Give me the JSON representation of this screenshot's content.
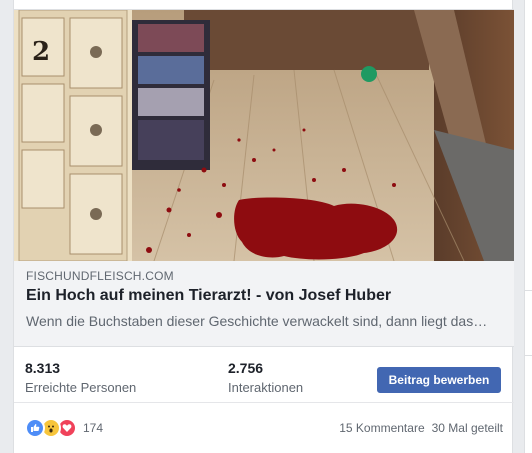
{
  "post": {
    "link": {
      "domain": "FISCHUNDFLEISCH.COM",
      "title": "Ein Hoch auf meinen Tierarzt! - von Josef Huber",
      "description": "Wenn die Buchstaben dieser Geschichte verwackelt sind, dann liegt das…"
    },
    "insights": {
      "reach_value": "8.313",
      "reach_label": "Erreichte Personen",
      "engagement_value": "2.756",
      "engagement_label": "Interaktionen",
      "boost_label": "Beitrag bewerben"
    },
    "footer": {
      "reaction_icons": [
        "like-icon",
        "wow-icon",
        "love-icon"
      ],
      "reaction_count": "174",
      "comments": "15 Kommentare",
      "shares": "30 Mal geteilt"
    },
    "photo": {
      "drawer_label": "2"
    }
  },
  "colors": {
    "accent": "#4267b2",
    "like": "#4e8df7",
    "wow": "#f7c53c",
    "love": "#f0425a",
    "blood": "#8e0c10"
  }
}
